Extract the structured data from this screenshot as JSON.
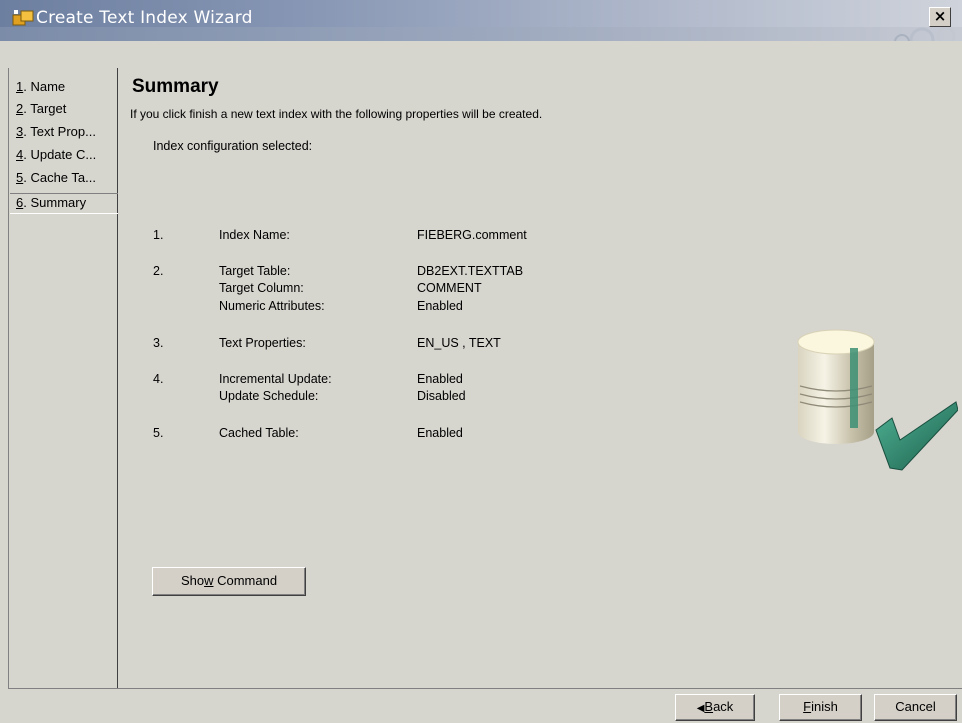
{
  "window": {
    "title": "Create Text Index Wizard",
    "close_label": "×"
  },
  "sidebar": {
    "items": [
      {
        "num": "1",
        "label": ". Name"
      },
      {
        "num": "2",
        "label": ". Target"
      },
      {
        "num": "3",
        "label": ". Text Prop..."
      },
      {
        "num": "4",
        "label": ". Update C..."
      },
      {
        "num": "5",
        "label": ". Cache Ta..."
      },
      {
        "num": "6",
        "label": ". Summary"
      }
    ],
    "selected_index": 6
  },
  "content": {
    "title": "Summary",
    "intro": "If you click finish a new text index with the following properties will be created.",
    "config_label": "Index configuration selected:",
    "rows": [
      {
        "num": "1.",
        "lines": [
          {
            "label": "Index Name:",
            "value": "FIEBERG.comment"
          }
        ]
      },
      {
        "num": "2.",
        "lines": [
          {
            "label": "Target Table:",
            "value": "DB2EXT.TEXTTAB"
          },
          {
            "label": "Target Column:",
            "value": "COMMENT"
          },
          {
            "label": "Numeric Attributes:",
            "value": "Enabled"
          }
        ]
      },
      {
        "num": "3.",
        "lines": [
          {
            "label": "Text Properties:",
            "value": "EN_US , TEXT"
          }
        ]
      },
      {
        "num": "4.",
        "lines": [
          {
            "label": "Incremental Update:",
            "value": "Enabled"
          },
          {
            "label": "Update Schedule:",
            "value": "Disabled"
          }
        ]
      },
      {
        "num": "5.",
        "lines": [
          {
            "label": "Cached Table:",
            "value": "Enabled"
          }
        ]
      }
    ],
    "show_command": {
      "pre": "Sho",
      "mnemonic": "w",
      "post": " Command"
    }
  },
  "footer": {
    "back": {
      "arrow": "◀",
      "mnemonic": "B",
      "rest": "ack"
    },
    "finish": {
      "mnemonic": "F",
      "rest": "inish"
    },
    "cancel": "Cancel"
  },
  "colors": {
    "dialog_bg": "#d6d5ce",
    "titlebar_left": "#6d7fa0",
    "titlebar_right": "#cfd3db",
    "check_green": "#2e8b6e"
  },
  "icons": [
    "wizard-app-icon",
    "close-icon",
    "database-check-illustration",
    "back-arrow-icon"
  ]
}
